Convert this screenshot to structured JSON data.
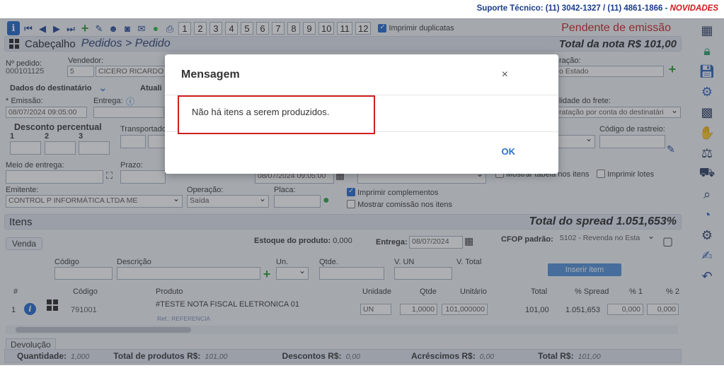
{
  "support": {
    "label": "Suporte Técnico:",
    "phones": "(11) 3042-1327 / (11) 4861-1866",
    "sep": " - ",
    "news": "NOVIDADES"
  },
  "toolbar": {
    "pages": [
      "1",
      "2",
      "3",
      "4",
      "5",
      "6",
      "7",
      "8",
      "9",
      "10",
      "11",
      "12"
    ],
    "print_duplicates_label": "Imprimir duplicatas",
    "print_duplicates_checked": true,
    "status": "Pendente de emissão"
  },
  "header": {
    "title": "Cabeçalho",
    "breadcrumb": "Pedidos > Pedido",
    "total_label": "Total da nota R$ 101,00"
  },
  "order": {
    "num_label": "Nº pedido:",
    "num_value": "000101125",
    "seller_label": "Vendedor:",
    "seller_code": "5",
    "seller_name": "CICERO RICARDO",
    "operation_partial": "ração:",
    "operation_value": "o Estado",
    "recipient_label": "Dados do destinatário",
    "update_label": "Atuali",
    "emission_label": "* Emissão:",
    "emission_value": "08/07/2024 09:05:00",
    "delivery_label": "Entrega:",
    "freight_label": "lidade do frete:",
    "freight_value": "ratação por conta do destinatári",
    "discount_label": "Desconto percentual",
    "d1": "1",
    "d2": "2",
    "d3": "3",
    "carrier_label": "Transportado",
    "tracking_label": "Código de rastreio:",
    "delivery_method_label": "Meio de entrega:",
    "term_label": "Prazo:",
    "date2_value": "08/07/2024 09:05:00",
    "show_table_label": "Mostrar tabela nos itens",
    "print_lots_label": "Imprimir lotes",
    "issuer_label": "Emitente:",
    "issuer_value": "CONTROL P INFORMÁTICA LTDA ME",
    "op_label": "Operação:",
    "op_value": "Saída",
    "plate_label": "Placa:",
    "print_compl_label": "Imprimir complementos",
    "show_comm_label": "Mostrar comissão nos itens"
  },
  "items_section": {
    "title": "Itens",
    "spread_label": "Total do spread 1.051,653%"
  },
  "items": {
    "sale_tab": "Venda",
    "stock_label": "Estoque do produto:",
    "stock_value": "0,000",
    "delivery_label": "Entrega:",
    "delivery_value": "08/07/2024",
    "cfop_label": "CFOP padrão:",
    "cfop_value": "5102 - Revenda no Esta",
    "code_label": "Código",
    "desc_label": "Descrição",
    "un_label": "Un.",
    "qty_label": "Qtde.",
    "vun_label": "V. UN",
    "vtotal_label": "V. Total",
    "insert_btn": "Inserir item",
    "cols": [
      "#",
      "Código",
      "Produto",
      "Unidade",
      "Qtde",
      "Unitário",
      "Total",
      "% Spread",
      "% 1",
      "% 2"
    ],
    "row": {
      "n": "1",
      "code": "791001",
      "product": "#TESTE NOTA FISCAL ELETRONICA 01",
      "ref": "Ref.: REFERENCIA",
      "unit": "UN",
      "qty": "1,0000",
      "unit_price": "101,000000",
      "total": "101,00",
      "spread": "1.051,653",
      "p1": "0,000",
      "p2": "0,000"
    },
    "devolucao": "Devolução"
  },
  "footer": {
    "qty_label": "Quantidade:",
    "qty_value": "1,000",
    "products_label": "Total de produtos R$:",
    "products_value": "101,00",
    "discounts_label": "Descontos R$:",
    "discounts_value": "0,00",
    "additions_label": "Acréscimos R$:",
    "additions_value": "0,00",
    "total_label": "Total R$:",
    "total_value": "101,00"
  },
  "modal": {
    "title": "Mensagem",
    "close": "×",
    "message": "Não há itens a serem produzidos.",
    "ok": "OK"
  }
}
